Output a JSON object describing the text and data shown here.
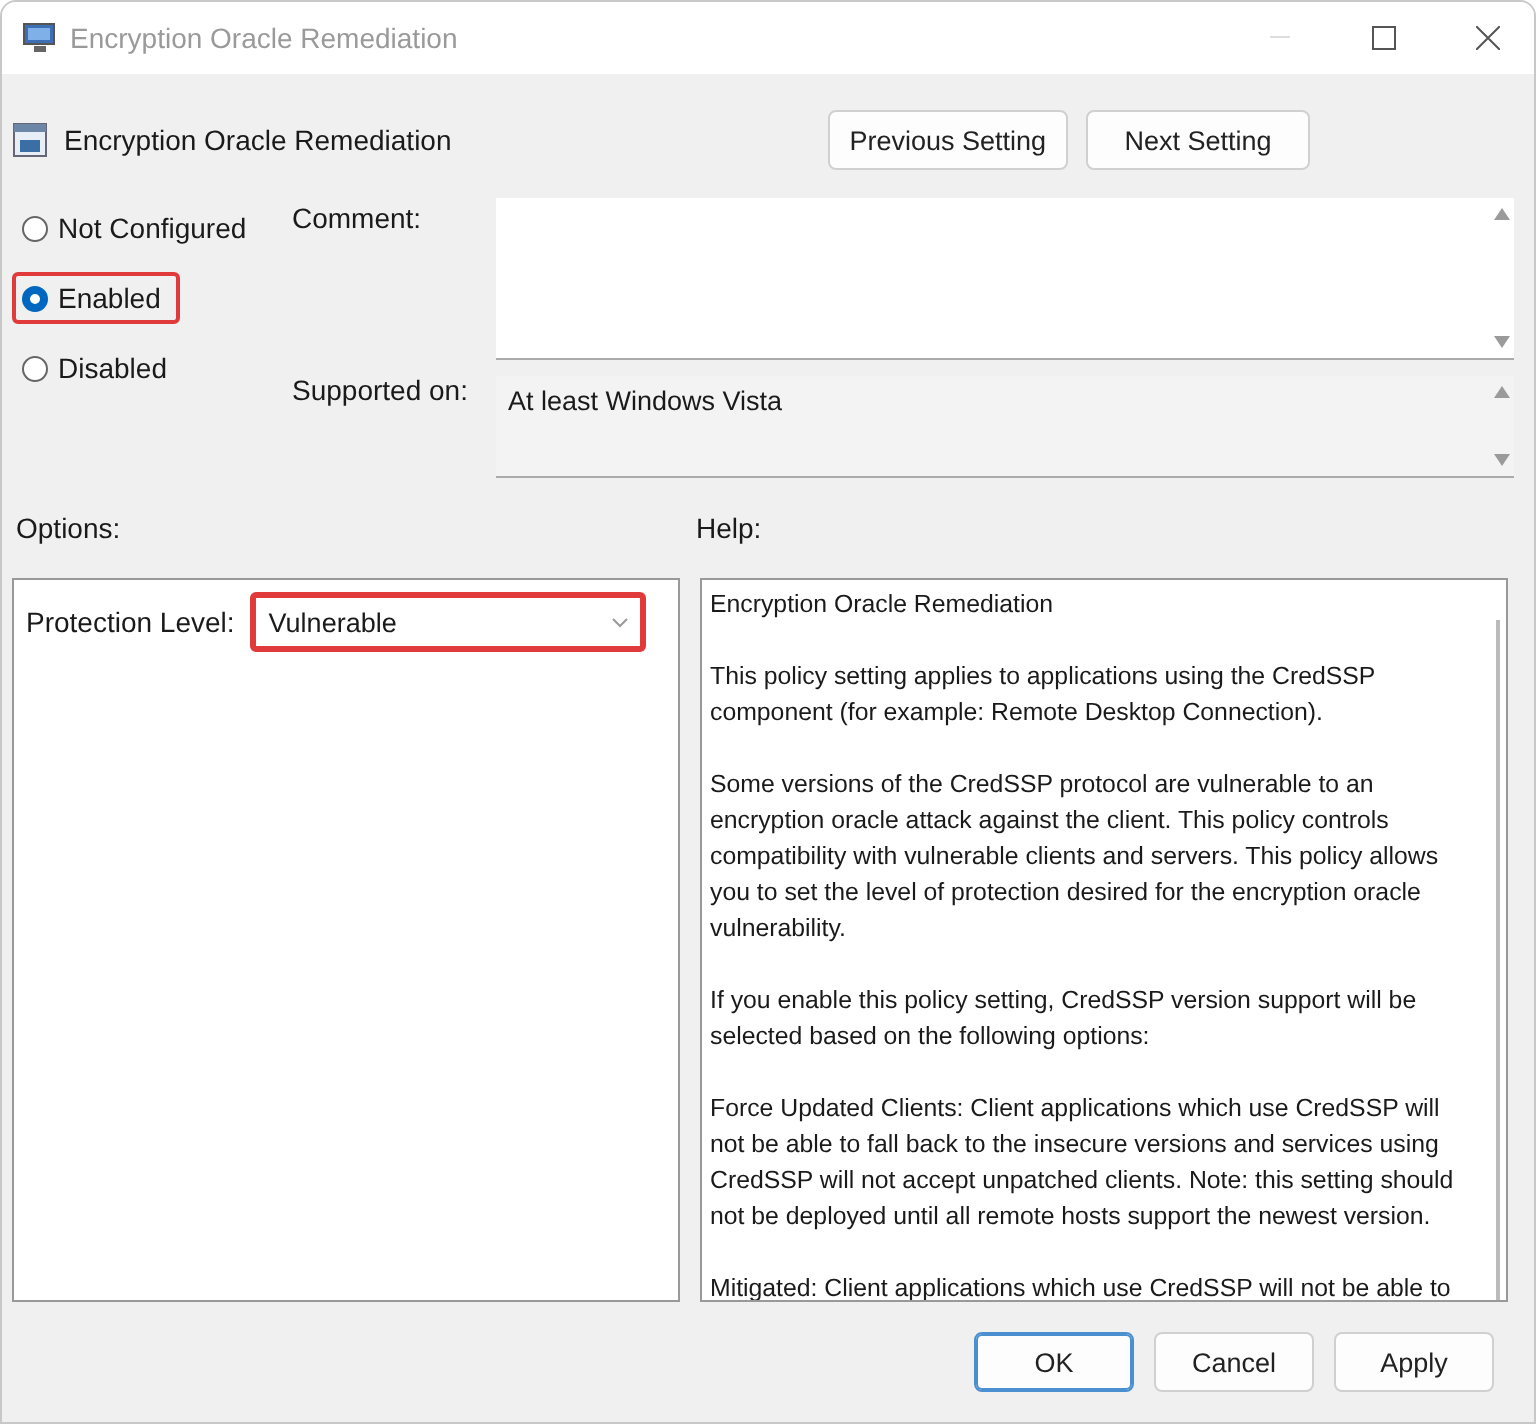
{
  "window": {
    "title": "Encryption Oracle Remediation"
  },
  "policy": {
    "title": "Encryption Oracle Remediation"
  },
  "nav_buttons": [
    "Previous Setting",
    "Next Setting"
  ],
  "states": [
    {
      "label": "Not Configured",
      "selected": false,
      "highlighted": false
    },
    {
      "label": "Enabled",
      "selected": true,
      "highlighted": true
    },
    {
      "label": "Disabled",
      "selected": false,
      "highlighted": false
    }
  ],
  "comment": {
    "label": "Comment:"
  },
  "supported_on": {
    "label": "Supported on:",
    "value": "At least Windows Vista"
  },
  "options": {
    "label": "Options:",
    "protection_level": {
      "label": "Protection Level:",
      "value": "Vulnerable",
      "highlighted": true
    }
  },
  "help": {
    "label": "Help:",
    "paragraphs": [
      [
        "Encryption Oracle Remediation"
      ],
      [
        "This policy setting applies to applications using the CredSSP",
        "component (for example: Remote Desktop Connection)."
      ],
      [
        "Some versions of the CredSSP protocol are vulnerable to an",
        "encryption oracle attack against the client.  This policy controls",
        "compatibility with vulnerable clients and servers.  This policy allows",
        "you to set the level of protection desired for the encryption oracle",
        "vulnerability."
      ],
      [
        "If you enable this policy setting, CredSSP version support will be",
        "selected based on the following options:"
      ],
      [
        "Force Updated Clients: Client applications which use CredSSP will",
        "not be able to fall back to the insecure versions and services using",
        "CredSSP will not accept unpatched clients. Note: this setting should",
        "not be deployed until all remote hosts support the newest version."
      ],
      [
        "Mitigated: Client applications which use CredSSP will not be able to"
      ]
    ]
  },
  "buttons": [
    {
      "label": "OK",
      "default": true
    },
    {
      "label": "Cancel",
      "default": false
    },
    {
      "label": "Apply",
      "default": false
    }
  ]
}
